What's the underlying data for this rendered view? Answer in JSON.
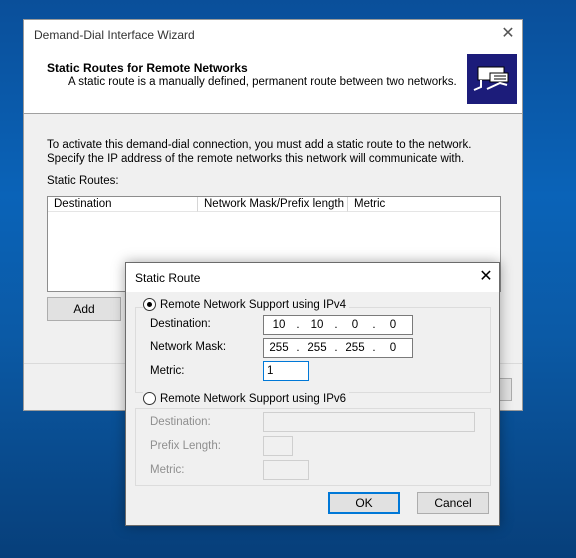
{
  "wizard": {
    "title": "Demand-Dial Interface Wizard",
    "close_glyph": "✕",
    "header_title": "Static Routes for Remote Networks",
    "header_subtitle": "A static route is a manually defined, permanent route between two networks.",
    "intro": "To activate this demand-dial connection, you must add a static route to the network. Specify the IP address of the remote networks this network will communicate with.",
    "routes_label": "Static Routes:",
    "columns": [
      "Destination",
      "Network Mask/Prefix length",
      "Metric"
    ],
    "add_label": "Add"
  },
  "dialog": {
    "title": "Static Route",
    "close_glyph": "✕",
    "ipv4": {
      "label": "Remote Network Support using IPv4",
      "selected": true,
      "destination_label": "Destination:",
      "destination": [
        "10",
        "10",
        "0",
        "0"
      ],
      "mask_label": "Network Mask:",
      "mask": [
        "255",
        "255",
        "255",
        "0"
      ],
      "metric_label": "Metric:",
      "metric": "1"
    },
    "ipv6": {
      "label": "Remote Network Support using IPv6",
      "selected": false,
      "destination_label": "Destination:",
      "prefix_label": "Prefix Length:",
      "metric_label": "Metric:"
    },
    "ok_label": "OK",
    "cancel_label": "Cancel"
  },
  "colors": {
    "accent": "#0078d7",
    "header_icon_bg": "#1c1c7a"
  }
}
